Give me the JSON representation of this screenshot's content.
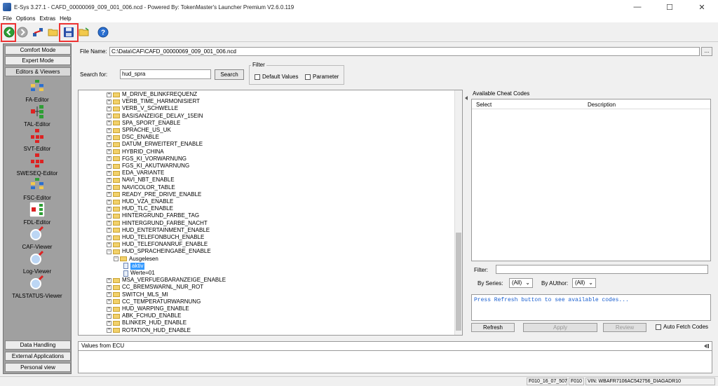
{
  "window": {
    "title": "E-Sys 3.27.1 - CAFD_00000069_009_001_006.ncd  - Powered By: TokenMaster's Launcher Premium V2.6.0.119",
    "minimize": "—",
    "maximize": "☐",
    "close": "✕"
  },
  "menu": [
    "File",
    "Options",
    "Extras",
    "Help"
  ],
  "toolbar": {
    "icons": [
      "back-icon",
      "forward-icon",
      "connect-icon",
      "open-folder-icon",
      "save-icon",
      "open-icon",
      "help-icon"
    ],
    "help_glyph": "?"
  },
  "leftnav": {
    "top_buttons": [
      "Comfort Mode",
      "Expert Mode",
      "Editors & Viewers"
    ],
    "tools": [
      "FA-Editor",
      "TAL-Editor",
      "SVT-Editor",
      "SWESEQ-Editor",
      "FSC-Editor",
      "FDL-Editor",
      "CAF-Viewer",
      "Log-Viewer",
      "TALSTATUS-Viewer"
    ],
    "bottom_buttons": [
      "Data Handling",
      "External Applications",
      "Personal view"
    ]
  },
  "file": {
    "label": "File Name:",
    "value": "C:\\Data\\CAF\\CAFD_00000069_009_001_006.ncd",
    "browse": "..."
  },
  "search": {
    "label": "Search for:",
    "value": "hud_spra",
    "button": "Search"
  },
  "filter": {
    "legend": "Filter",
    "default_values": "Default Values",
    "parameter": "Parameter"
  },
  "tree": {
    "nodes": [
      "M_DRIVE_BLINKFREQUENZ",
      "VERB_TIME_HARMONISIERT",
      "VERB_V_SCHWELLE",
      "BASISANZEIGE_DELAY_15EIN",
      "SPA_SPORT_ENABLE",
      "SPRACHE_US_UK",
      "DSC_ENABLE",
      "DATUM_ERWEITERT_ENABLE",
      "HYBRID_CHINA",
      "FGS_KI_VORWARNUNG",
      "FGS_KI_AKUTWARNUNG",
      "EDA_VARIANTE",
      "NAVI_NBT_ENABLE",
      "NAVICOLOR_TABLE",
      "READY_PRE_DRIVE_ENABLE",
      "HUD_VZA_ENABLE",
      "HUD_TLC_ENABLE",
      "HINTERGRUND_FARBE_TAG",
      "HINTERGRUND_FARBE_NACHT",
      "HUD_ENTERTAINMENT_ENABLE",
      "HUD_TELEFONBUCH_ENABLE",
      "HUD_TELEFONANRUF_ENABLE",
      "HUD_SPRACHEINGABE_ENABLE"
    ],
    "expanded_child": "Ausgelesen",
    "value_selected": "aktiv",
    "value_other": "Werte=01",
    "nodes_after": [
      "MSA_VERFUEGBARANZEIGE_ENABLE",
      "CC_BREMSWARNL_NUR_ROT",
      "SWITCH_MLS_MI",
      "CC_TEMPERATURWARNUNG",
      "HUD_WARPING_ENABLE",
      "ABK_FCHUD_ENABLE",
      "BLINKER_HUD_ENABLE",
      "ROTATION_HUD_ENABLE"
    ]
  },
  "cheat": {
    "title": "Available Cheat Codes",
    "col_select": "Select",
    "col_description": "Description",
    "filter_label": "Filter:",
    "by_series_label": "By Series:",
    "by_series_value": "(All)",
    "by_author_label": "By AUthor:",
    "by_author_value": "(All)",
    "console": "Press Refresh button to see available codes...",
    "refresh": "Refresh",
    "apply": "Apply",
    "review": "Review",
    "auto_fetch": "Auto Fetch Codes"
  },
  "values": {
    "title": "Values from ECU"
  },
  "status": {
    "cells": [
      "F010_16_07_507",
      "F010",
      "VIN: WBAFR7106AC542756_DIAGADR10"
    ]
  },
  "colors": {
    "accent_red": "#e33333",
    "selection_blue": "#3399ff",
    "console_blue": "#1a5fd0",
    "nav_gray": "#a0a0a0"
  }
}
